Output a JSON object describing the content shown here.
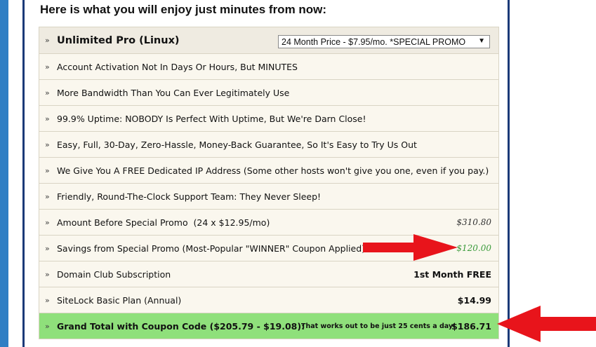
{
  "heading": "Here is what you will enjoy just minutes from now:",
  "plan": {
    "name": "Unlimited Pro (Linux)",
    "selected_term": "24 Month Price - $7.95/mo. *SPECIAL PROMO"
  },
  "chevron": "»",
  "caret": "▼",
  "features": [
    "Account Activation Not In Days Or Hours, But MINUTES",
    "More Bandwidth Than You Can Ever Legitimately Use",
    "99.9% Uptime: NOBODY Is Perfect With Uptime, But We're Darn Close!",
    "Easy, Full, 30-Day, Zero-Hassle, Money-Back Guarantee, So It's Easy to Try Us Out",
    "We Give You A FREE Dedicated IP Address (Some other hosts won't give you one, even if you pay.)",
    "Friendly, Round-The-Clock Support Team: They Never Sleep!"
  ],
  "pricing": {
    "before_promo_label": "Amount Before Special Promo  (24 x $12.95/mo)",
    "before_promo_value": "$310.80",
    "savings_label": "Savings from Special Promo (Most-Popular \"WINNER\" Coupon Applied)",
    "savings_value": "- $120.00",
    "domain_label": "Domain Club Subscription",
    "domain_value": "1st Month FREE",
    "sitelock_label": "SiteLock Basic Plan (Annual)",
    "sitelock_value": "$14.99",
    "total_label": "Grand Total with Coupon Code ($205.79 - $19.08):",
    "total_note": "That works out to be just 25 cents a day!",
    "total_value": "$186.71"
  },
  "colors": {
    "accent_blue": "#2f7fc4",
    "border_navy": "#1b3a78",
    "total_green": "#8fe07b",
    "arrow_red": "#e8141b",
    "savings_green": "#3a9a3a"
  }
}
